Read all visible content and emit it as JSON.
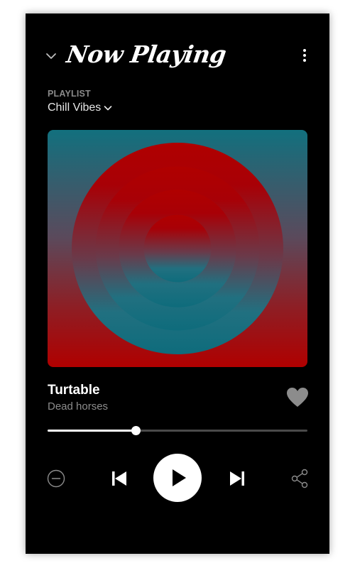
{
  "header": {
    "title": "Now Playing",
    "collapse_icon": "chevron-down-icon",
    "menu_icon": "more-vertical-icon"
  },
  "playlist": {
    "label": "PLAYLIST",
    "name": "Chill Vibes",
    "dropdown_icon": "chevron-down-icon"
  },
  "track": {
    "title": "Turtable",
    "artist": "Dead horses",
    "liked": true
  },
  "playback": {
    "progress": 0.34
  },
  "controls": {
    "icons": [
      "minus-circle-icon",
      "skip-previous-icon",
      "play-icon",
      "skip-next-icon",
      "share-icon"
    ]
  },
  "colors": {
    "background": "#000000",
    "art_teal": "#12707e",
    "art_red": "#b00000",
    "text_primary": "#ffffff",
    "text_secondary": "#8c8c8c",
    "heart": "#8c8c8c"
  }
}
